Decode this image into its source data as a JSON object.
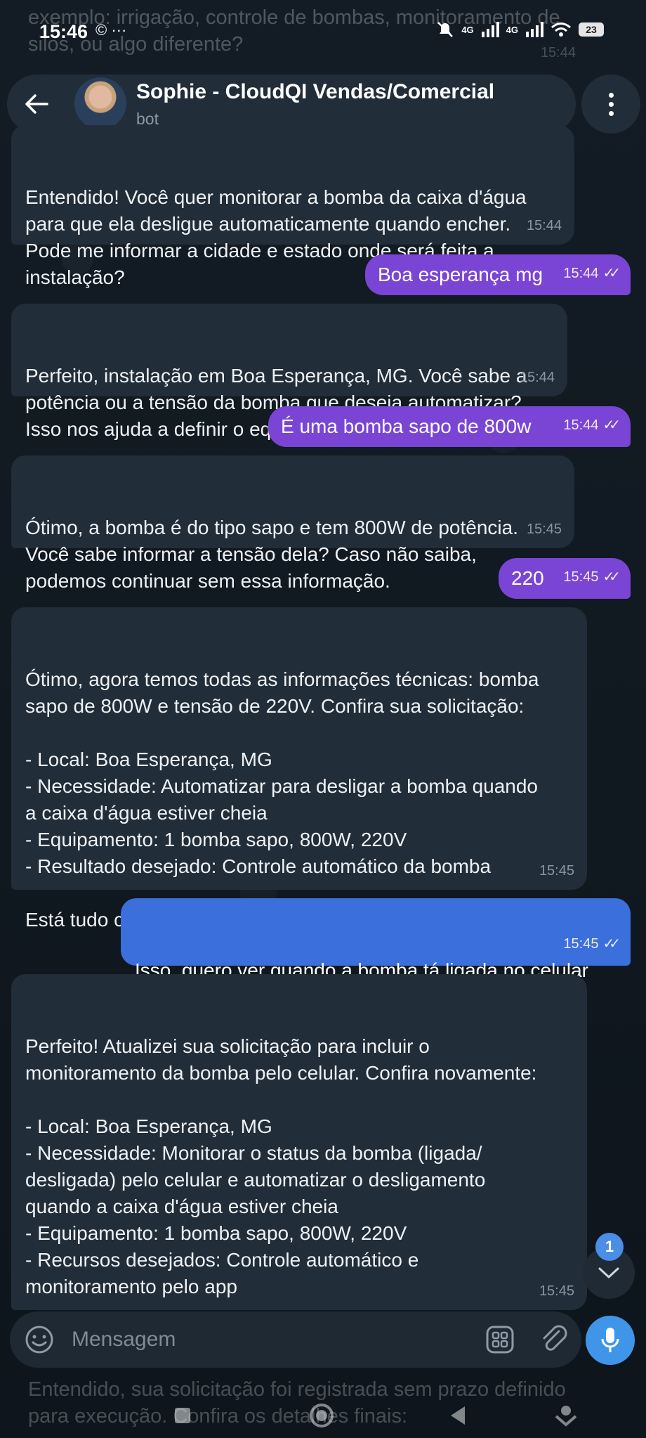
{
  "status_bar": {
    "time": "15:46",
    "extra": "© ···",
    "network1": "4G",
    "network2": "4G",
    "battery": "23"
  },
  "background_text_top": "exemplo: irrigação, controle de bombas, monitoramento de silos, ou algo diferente?",
  "background_time_top": "15:44",
  "header": {
    "title": "Sophie - CloudQI Vendas/Comercial",
    "subtitle": "bot"
  },
  "messages": [
    {
      "dir": "in",
      "text": "Entendido! Você quer monitorar a bomba da caixa d'água\npara que ela desligue automaticamente quando encher.\nPode me informar a cidade e estado onde será feita a\ninstalação?",
      "time": "15:44"
    },
    {
      "dir": "out",
      "text": "Boa esperança mg",
      "time": "15:44"
    },
    {
      "dir": "in",
      "text": "Perfeito, instalação em Boa Esperança, MG. Você sabe a\npotência ou a tensão da bomba que deseja automatizar?\nIsso nos ajuda a definir o equipamento ideal.",
      "time": "15:44"
    },
    {
      "dir": "out",
      "text": "É uma bomba sapo de 800w",
      "time": "15:44"
    },
    {
      "dir": "in",
      "text": "Ótimo, a bomba é do tipo sapo e tem 800W de potência.\nVocê sabe informar a tensão dela? Caso não saiba,\npodemos continuar sem essa informação.",
      "time": "15:45"
    },
    {
      "dir": "out",
      "text": "220",
      "time": "15:45"
    },
    {
      "dir": "in",
      "text": "Ótimo, agora temos todas as informações técnicas: bomba\nsapo de 800W e tensão de 220V. Confira sua solicitação:\n\n- Local: Boa Esperança, MG\n- Necessidade: Automatizar para desligar a bomba quando\na caixa d'água estiver cheia\n- Equipamento: 1 bomba sapo, 800W, 220V\n- Resultado desejado: Controle automático da bomba\n\nEstá tudo correto?",
      "time": "15:45"
    },
    {
      "dir": "out",
      "text": "Isso, quero ver quando a bomba tá ligada no celular\ntambém",
      "time": "15:45"
    },
    {
      "dir": "in",
      "text": "Perfeito! Atualizei sua solicitação para incluir o\nmonitoramento da bomba pelo celular. Confira novamente:\n\n- Local: Boa Esperança, MG\n- Necessidade: Monitorar o status da bomba (ligada/\ndesligada) pelo celular e automatizar o desligamento\nquando a caixa d'água estiver cheia\n- Equipamento: 1 bomba sapo, 800W, 220V\n- Recursos desejados: Controle automático e\nmonitoramento pelo app\n\nEstá tudo certo agora?",
      "time": "15:45"
    }
  ],
  "unread_count": "1",
  "composer": {
    "placeholder": "Mensagem"
  },
  "background_text_bottom": "Entendido, sua solicitação foi registrada sem prazo definido para execução. Confira os detalhes finais:",
  "icons": {
    "back": "arrow-left-icon",
    "menu": "more-vertical-icon",
    "emoji": "emoji-icon",
    "apps": "grid-icon",
    "attach": "paperclip-icon",
    "mic": "microphone-icon",
    "scroll": "chevron-down-icon"
  },
  "colors": {
    "outgoing_bubble": "#7a45d4",
    "outgoing_bubble_last": "#3b6fdc",
    "incoming_bubble": "#212d38",
    "mic_button": "#3f96e8"
  }
}
